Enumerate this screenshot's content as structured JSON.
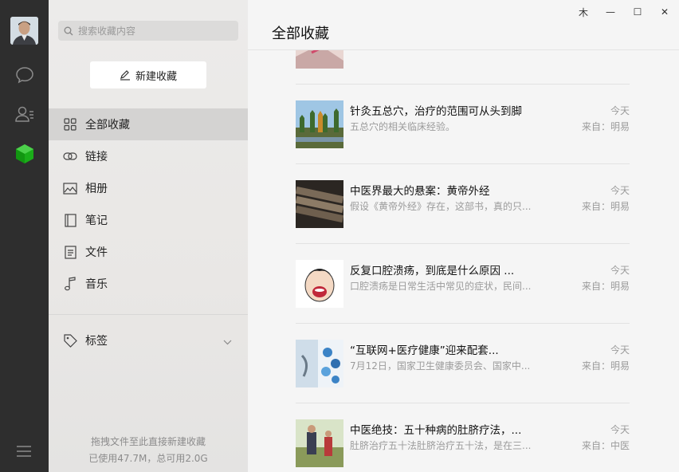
{
  "search": {
    "placeholder": "搜索收藏内容"
  },
  "new_button": {
    "label": "新建收藏"
  },
  "categories": [
    {
      "label": "全部收藏",
      "icon": "grid-icon",
      "active": true
    },
    {
      "label": "链接",
      "icon": "link-icon"
    },
    {
      "label": "相册",
      "icon": "image-icon"
    },
    {
      "label": "笔记",
      "icon": "note-icon"
    },
    {
      "label": "文件",
      "icon": "file-icon"
    },
    {
      "label": "音乐",
      "icon": "music-icon"
    }
  ],
  "tags": {
    "label": "标签"
  },
  "footer": {
    "hint": "拖拽文件至此直接新建收藏",
    "usage": "已使用47.7M，总可用2.0G"
  },
  "main": {
    "title": "全部收藏"
  },
  "window": {
    "pin": "⽊",
    "minimize": "—",
    "maximize": "☐",
    "close": "✕"
  },
  "items": [
    {
      "title": "",
      "sub": "",
      "time": "",
      "source": ""
    },
    {
      "title": "针灸五总穴，治疗的范围可从头到脚",
      "sub": "五总穴的相关临床经验。",
      "time": "今天",
      "source": "来自：明易"
    },
    {
      "title": "中医界最大的悬案：黄帝外经",
      "sub": "假设《黄帝外经》存在，这部书，真的只...",
      "time": "今天",
      "source": "来自：明易"
    },
    {
      "title": "反复口腔溃疡，到底是什么原因 ...",
      "sub": "口腔溃疡是日常生活中常见的症状，民间...",
      "time": "今天",
      "source": "来自：明易"
    },
    {
      "title": "“互联网+医疗健康”迎来配套...",
      "sub": "7月12日，国家卫生健康委员会、国家中...",
      "time": "今天",
      "source": "来自：明易"
    },
    {
      "title": "中医绝技：五十种病的肚脐疗法，...",
      "sub": "肚脐治疗五十法肚脐治疗五十法，是在三...",
      "time": "今天",
      "source": "来自：中医"
    }
  ]
}
